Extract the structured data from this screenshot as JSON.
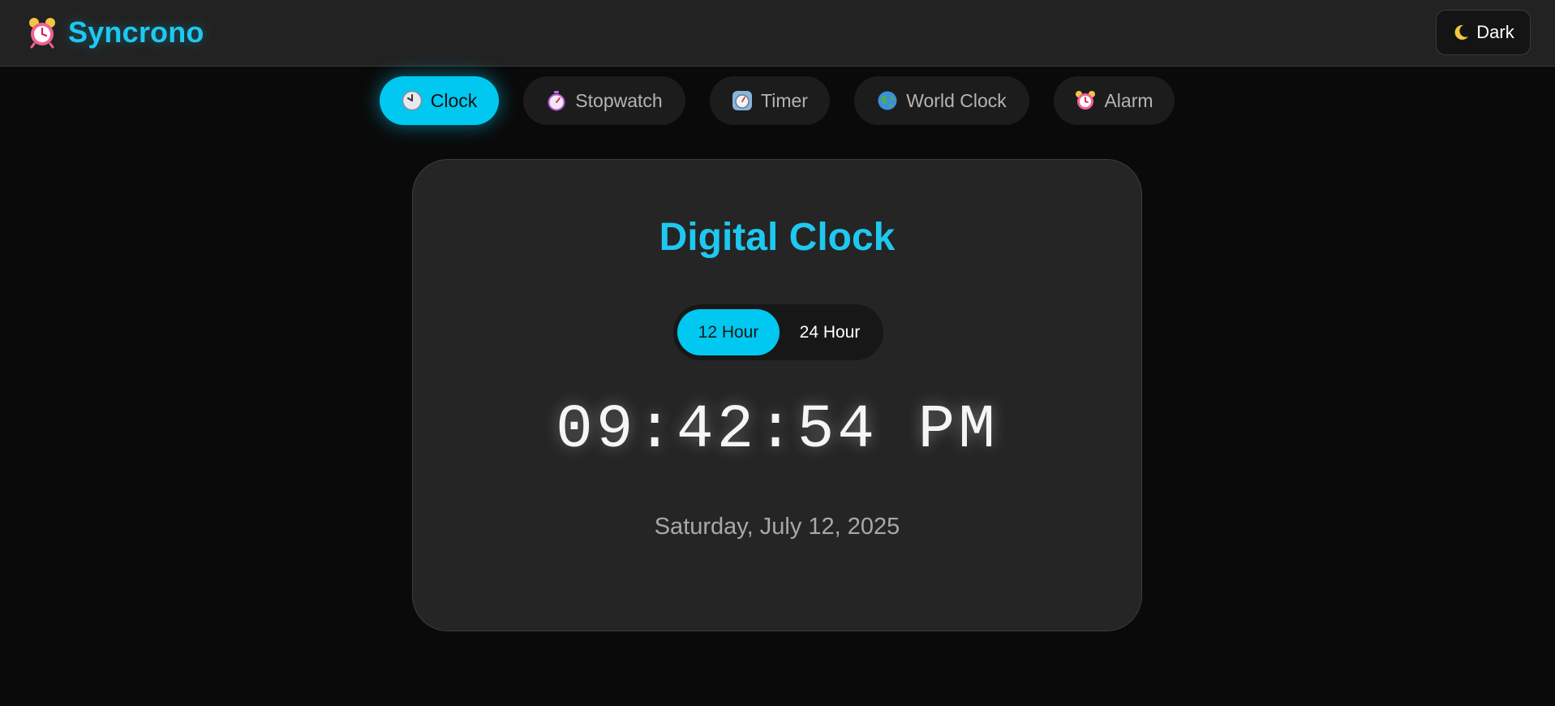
{
  "app": {
    "name": "Syncrono",
    "logo_icon": "alarm-clock-icon",
    "accent_color": "#00c8f0"
  },
  "theme_toggle": {
    "icon": "moon-icon",
    "label": "Dark"
  },
  "tabs": [
    {
      "label": "Clock",
      "icon": "clock-icon",
      "active": true
    },
    {
      "label": "Stopwatch",
      "icon": "stopwatch-icon",
      "active": false
    },
    {
      "label": "Timer",
      "icon": "timer-icon",
      "active": false
    },
    {
      "label": "World Clock",
      "icon": "globe-icon",
      "active": false
    },
    {
      "label": "Alarm",
      "icon": "alarm-clock-icon",
      "active": false
    }
  ],
  "clock": {
    "title": "Digital Clock",
    "format_options": [
      "12 Hour",
      "24 Hour"
    ],
    "selected_format": "12 Hour",
    "time": "09:42:54 PM",
    "date": "Saturday, July 12, 2025"
  }
}
